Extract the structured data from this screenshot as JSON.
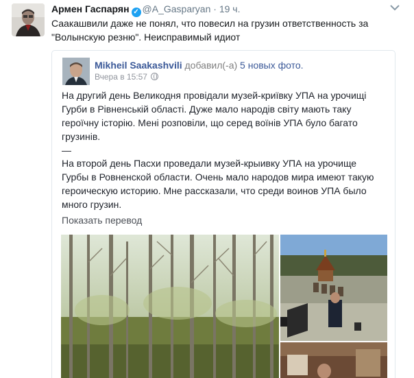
{
  "tweet": {
    "author_name": "Армен Гаспарян",
    "handle": "@A_Gasparyan",
    "time": "19 ч.",
    "text_line1": "Саакашвили даже не понял, что повесил на грузин ответственность за",
    "text_line2": "\"Волынскую резню\". Неисправимый идиот"
  },
  "post": {
    "author": "Mikheil Saakashvili",
    "action": "добавил(-а)",
    "photos": "5 новых фото.",
    "time": "Вчера в 15:57",
    "ukrainian_text": "На другий день Великодня провідали музей-криївку УПА на урочищі Гурби в Рівненській області. Дуже мало народів світу мають таку героїчну історію. Мені розповіли, що серед воїнів УПА було багато грузинів.",
    "dash": "—",
    "russian_text": "На второй день Пасхи проведали музей-крыивку УПА на урочище Гурбы в Ровненской области. Очень мало народов мира имеют такую героическую историю. Мне рассказали, что среди воинов УПА было много грузин.",
    "translate_link": "Показать перевод"
  },
  "icons": {
    "verified": "verified-badge-icon",
    "caret": "chevron-down-icon",
    "privacy": "globe-icon"
  },
  "colors": {
    "name": "#14171a",
    "muted": "#657786",
    "verified": "#1da1f2",
    "fb_link": "#3b5998",
    "fb_text": "#1d2129",
    "border": "#e1e8ed"
  }
}
